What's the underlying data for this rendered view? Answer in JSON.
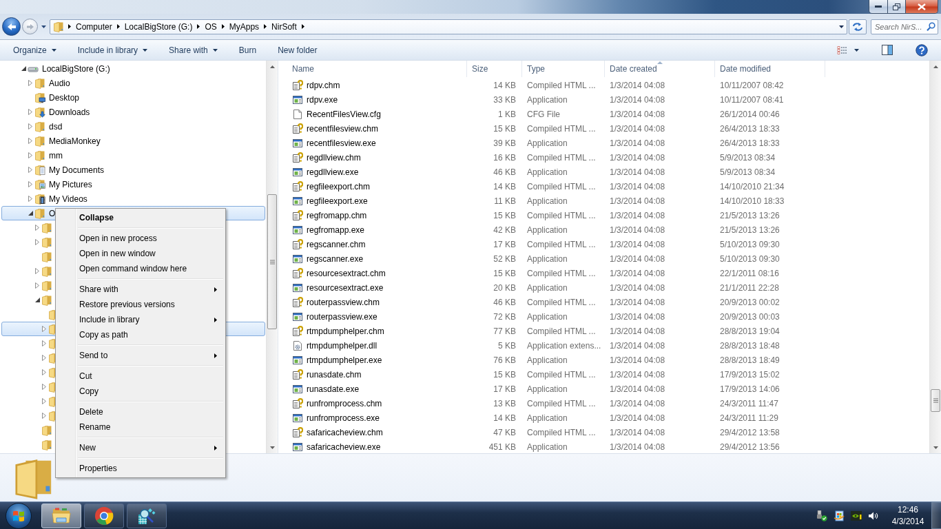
{
  "address_bar": {
    "breadcrumbs": [
      "Computer",
      "LocalBigStore (G:)",
      "OS",
      "MyApps",
      "NirSoft"
    ]
  },
  "search": {
    "placeholder": "Search NirS..."
  },
  "toolbar": {
    "items": [
      {
        "label": "Organize",
        "dropdown": true
      },
      {
        "label": "Include in library",
        "dropdown": true
      },
      {
        "label": "Share with",
        "dropdown": true
      },
      {
        "label": "Burn",
        "dropdown": false
      },
      {
        "label": "New folder",
        "dropdown": false
      }
    ]
  },
  "nav_tree": {
    "items": [
      {
        "kind": "drive",
        "label": "LocalBigStore (G:)",
        "expandable": true,
        "expanded": true,
        "selected": false,
        "children": [
          {
            "kind": "folder",
            "label": "Audio",
            "expandable": true,
            "expanded": false,
            "selected": false
          },
          {
            "kind": "desktop",
            "label": "Desktop",
            "expandable": false,
            "selected": false
          },
          {
            "kind": "downloads",
            "label": "Downloads",
            "expandable": true,
            "expanded": false,
            "selected": false
          },
          {
            "kind": "folder",
            "label": "dsd",
            "expandable": true,
            "expanded": false,
            "selected": false
          },
          {
            "kind": "folder",
            "label": "MediaMonkey",
            "expandable": true,
            "expanded": false,
            "selected": false
          },
          {
            "kind": "folder",
            "label": "mm",
            "expandable": true,
            "expanded": false,
            "selected": false
          },
          {
            "kind": "documents",
            "label": "My Documents",
            "expandable": true,
            "expanded": false,
            "selected": false
          },
          {
            "kind": "pictures",
            "label": "My Pictures",
            "expandable": true,
            "expanded": false,
            "selected": false
          },
          {
            "kind": "videos",
            "label": "My Videos",
            "expandable": true,
            "expanded": false,
            "selected": false
          },
          {
            "kind": "folder",
            "label": "O",
            "expandable": true,
            "expanded": true,
            "selected": true,
            "children": [
              {
                "kind": "folder",
                "expandable": true,
                "expanded": false,
                "selected": false
              },
              {
                "kind": "folder",
                "expandable": true,
                "expanded": false,
                "selected": false
              },
              {
                "kind": "folder",
                "expandable": false,
                "selected": false
              },
              {
                "kind": "folder",
                "expandable": true,
                "expanded": false,
                "selected": false
              },
              {
                "kind": "folder",
                "expandable": true,
                "expanded": false,
                "selected": false
              },
              {
                "kind": "folder",
                "expandable": true,
                "expanded": true,
                "selected": false,
                "children": [
                  {
                    "kind": "folder",
                    "expandable": false,
                    "selected": false
                  },
                  {
                    "kind": "folder",
                    "expandable": true,
                    "expanded": false,
                    "selected": true
                  },
                  {
                    "kind": "folder",
                    "expandable": true,
                    "expanded": false,
                    "selected": false
                  },
                  {
                    "kind": "folder",
                    "expandable": true,
                    "expanded": false,
                    "selected": false
                  },
                  {
                    "kind": "folder",
                    "expandable": true,
                    "expanded": false,
                    "selected": false
                  },
                  {
                    "kind": "folder",
                    "expandable": true,
                    "expanded": false,
                    "selected": false
                  },
                  {
                    "kind": "folder",
                    "expandable": true,
                    "expanded": false,
                    "selected": false
                  },
                  {
                    "kind": "folder",
                    "expandable": true,
                    "expanded": false,
                    "selected": false
                  }
                ]
              },
              {
                "kind": "folder",
                "expandable": false,
                "selected": false
              },
              {
                "kind": "folder",
                "expandable": false,
                "selected": false
              }
            ]
          }
        ]
      }
    ]
  },
  "file_list": {
    "columns": [
      {
        "label": "Name",
        "sorted": false
      },
      {
        "label": "Size",
        "sorted": false
      },
      {
        "label": "Type",
        "sorted": false
      },
      {
        "label": "Date created",
        "sorted": true
      },
      {
        "label": "Date modified",
        "sorted": false
      }
    ],
    "rows": [
      {
        "kind": "chm",
        "name": "rdpv.chm",
        "size": "14 KB",
        "type": "Compiled HTML ...",
        "created": "1/3/2014 04:08",
        "modified": "10/11/2007 08:42"
      },
      {
        "kind": "exe",
        "name": "rdpv.exe",
        "size": "33 KB",
        "type": "Application",
        "created": "1/3/2014 04:08",
        "modified": "10/11/2007 08:41"
      },
      {
        "kind": "cfg",
        "name": "RecentFilesView.cfg",
        "size": "1 KB",
        "type": "CFG File",
        "created": "1/3/2014 04:08",
        "modified": "26/1/2014 00:46"
      },
      {
        "kind": "chm",
        "name": "recentfilesview.chm",
        "size": "15 KB",
        "type": "Compiled HTML ...",
        "created": "1/3/2014 04:08",
        "modified": "26/4/2013 18:33"
      },
      {
        "kind": "exe",
        "name": "recentfilesview.exe",
        "size": "39 KB",
        "type": "Application",
        "created": "1/3/2014 04:08",
        "modified": "26/4/2013 18:33"
      },
      {
        "kind": "chm",
        "name": "regdllview.chm",
        "size": "16 KB",
        "type": "Compiled HTML ...",
        "created": "1/3/2014 04:08",
        "modified": "5/9/2013 08:34"
      },
      {
        "kind": "exe",
        "name": "regdllview.exe",
        "size": "46 KB",
        "type": "Application",
        "created": "1/3/2014 04:08",
        "modified": "5/9/2013 08:34"
      },
      {
        "kind": "chm",
        "name": "regfileexport.chm",
        "size": "14 KB",
        "type": "Compiled HTML ...",
        "created": "1/3/2014 04:08",
        "modified": "14/10/2010 21:34"
      },
      {
        "kind": "exe",
        "name": "regfileexport.exe",
        "size": "11 KB",
        "type": "Application",
        "created": "1/3/2014 04:08",
        "modified": "14/10/2010 18:33"
      },
      {
        "kind": "chm",
        "name": "regfromapp.chm",
        "size": "15 KB",
        "type": "Compiled HTML ...",
        "created": "1/3/2014 04:08",
        "modified": "21/5/2013 13:26"
      },
      {
        "kind": "exe",
        "name": "regfromapp.exe",
        "size": "42 KB",
        "type": "Application",
        "created": "1/3/2014 04:08",
        "modified": "21/5/2013 13:26"
      },
      {
        "kind": "chm",
        "name": "regscanner.chm",
        "size": "17 KB",
        "type": "Compiled HTML ...",
        "created": "1/3/2014 04:08",
        "modified": "5/10/2013 09:30"
      },
      {
        "kind": "exe",
        "name": "regscanner.exe",
        "size": "52 KB",
        "type": "Application",
        "created": "1/3/2014 04:08",
        "modified": "5/10/2013 09:30"
      },
      {
        "kind": "chm",
        "name": "resourcesextract.chm",
        "size": "15 KB",
        "type": "Compiled HTML ...",
        "created": "1/3/2014 04:08",
        "modified": "22/1/2011 08:16"
      },
      {
        "kind": "exe",
        "name": "resourcesextract.exe",
        "size": "20 KB",
        "type": "Application",
        "created": "1/3/2014 04:08",
        "modified": "21/1/2011 22:28"
      },
      {
        "kind": "chm",
        "name": "routerpassview.chm",
        "size": "46 KB",
        "type": "Compiled HTML ...",
        "created": "1/3/2014 04:08",
        "modified": "20/9/2013 00:02"
      },
      {
        "kind": "exe",
        "name": "routerpassview.exe",
        "size": "72 KB",
        "type": "Application",
        "created": "1/3/2014 04:08",
        "modified": "20/9/2013 00:03"
      },
      {
        "kind": "chm",
        "name": "rtmpdumphelper.chm",
        "size": "77 KB",
        "type": "Compiled HTML ...",
        "created": "1/3/2014 04:08",
        "modified": "28/8/2013 19:04"
      },
      {
        "kind": "dll",
        "name": "rtmpdumphelper.dll",
        "size": "5 KB",
        "type": "Application extens...",
        "created": "1/3/2014 04:08",
        "modified": "28/8/2013 18:48"
      },
      {
        "kind": "exe",
        "name": "rtmpdumphelper.exe",
        "size": "76 KB",
        "type": "Application",
        "created": "1/3/2014 04:08",
        "modified": "28/8/2013 18:49"
      },
      {
        "kind": "chm",
        "name": "runasdate.chm",
        "size": "15 KB",
        "type": "Compiled HTML ...",
        "created": "1/3/2014 04:08",
        "modified": "17/9/2013 15:02"
      },
      {
        "kind": "exe",
        "name": "runasdate.exe",
        "size": "17 KB",
        "type": "Application",
        "created": "1/3/2014 04:08",
        "modified": "17/9/2013 14:06"
      },
      {
        "kind": "chm",
        "name": "runfromprocess.chm",
        "size": "13 KB",
        "type": "Compiled HTML ...",
        "created": "1/3/2014 04:08",
        "modified": "24/3/2011 11:47"
      },
      {
        "kind": "exe",
        "name": "runfromprocess.exe",
        "size": "14 KB",
        "type": "Application",
        "created": "1/3/2014 04:08",
        "modified": "24/3/2011 11:29"
      },
      {
        "kind": "chm",
        "name": "safaricacheview.chm",
        "size": "47 KB",
        "type": "Compiled HTML ...",
        "created": "1/3/2014 04:08",
        "modified": "29/4/2012 13:58"
      },
      {
        "kind": "exe",
        "name": "safaricacheview.exe",
        "size": "451 KB",
        "type": "Application",
        "created": "1/3/2014 04:08",
        "modified": "29/4/2012 13:56"
      }
    ]
  },
  "context_menu": {
    "groups": [
      {
        "items": [
          {
            "label": "Collapse",
            "default": true,
            "submenu": false
          }
        ]
      },
      {
        "items": [
          {
            "label": "Open in new process",
            "default": false,
            "submenu": false
          },
          {
            "label": "Open in new window",
            "default": false,
            "submenu": false
          },
          {
            "label": "Open command window here",
            "default": false,
            "submenu": false
          }
        ]
      },
      {
        "items": [
          {
            "label": "Share with",
            "default": false,
            "submenu": true
          },
          {
            "label": "Restore previous versions",
            "default": false,
            "submenu": false
          },
          {
            "label": "Include in library",
            "default": false,
            "submenu": true
          },
          {
            "label": "Copy as path",
            "default": false,
            "submenu": false
          }
        ]
      },
      {
        "items": [
          {
            "label": "Send to",
            "default": false,
            "submenu": true
          }
        ]
      },
      {
        "items": [
          {
            "label": "Cut",
            "default": false,
            "submenu": false
          },
          {
            "label": "Copy",
            "default": false,
            "submenu": false
          }
        ]
      },
      {
        "items": [
          {
            "label": "Delete",
            "default": false,
            "submenu": false
          },
          {
            "label": "Rename",
            "default": false,
            "submenu": false
          }
        ]
      },
      {
        "items": [
          {
            "label": "New",
            "default": false,
            "submenu": true
          }
        ]
      },
      {
        "items": [
          {
            "label": "Properties",
            "default": false,
            "submenu": false
          }
        ]
      }
    ]
  },
  "taskbar": {
    "buttons": [
      {
        "kind": "explorer",
        "selected": true
      },
      {
        "kind": "browser",
        "selected": false
      },
      {
        "kind": "scanner",
        "selected": false
      }
    ],
    "clock": {
      "time": "12:46",
      "date": "4/3/2014"
    }
  }
}
